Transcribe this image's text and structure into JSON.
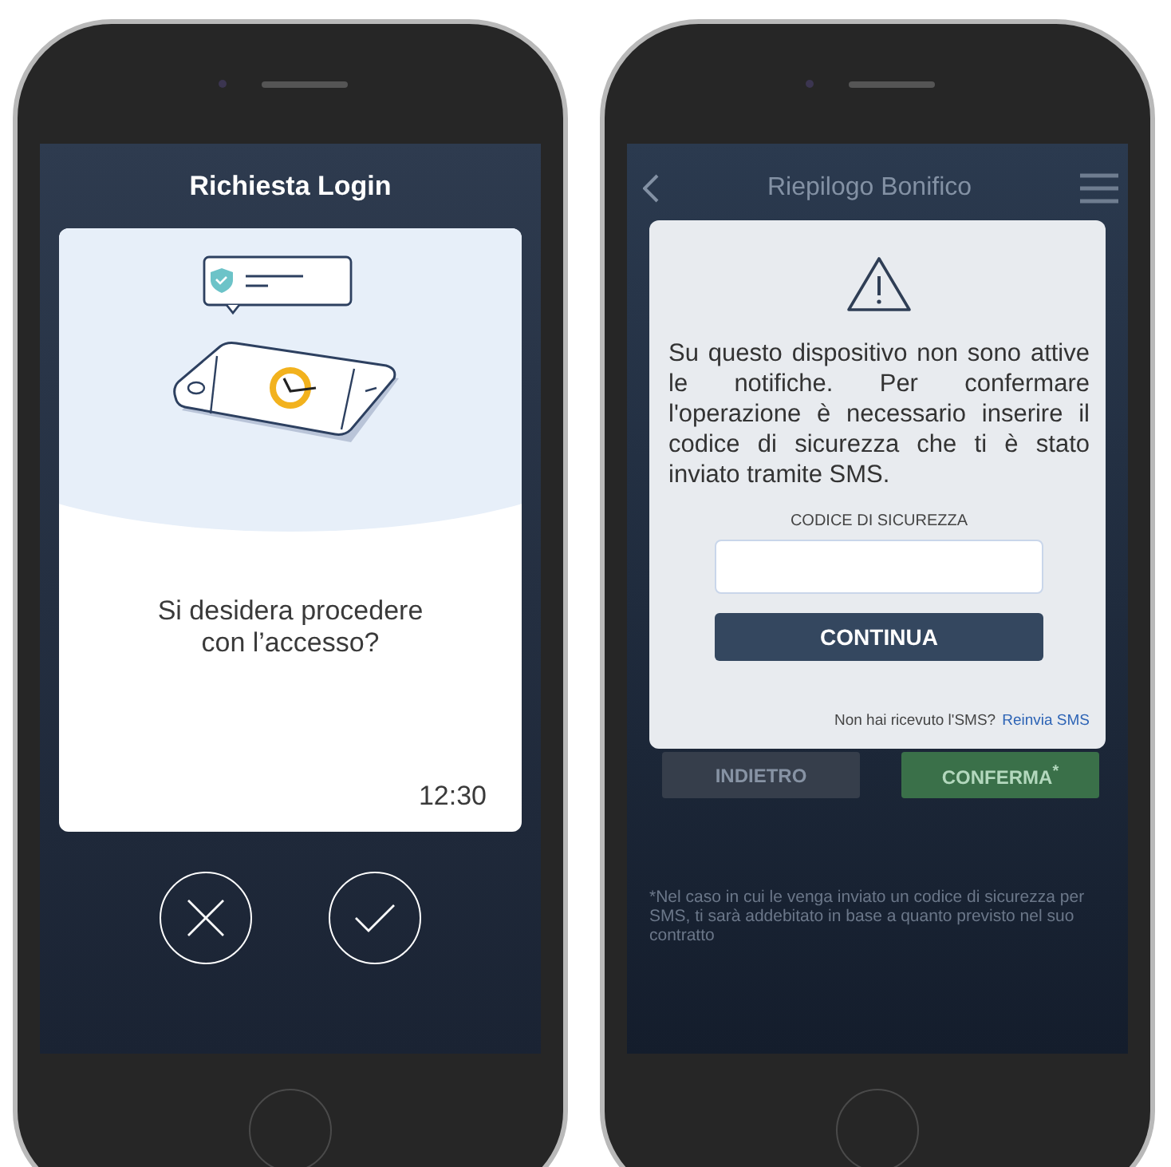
{
  "login_phone": {
    "title": "Richiesta Login",
    "question": "Si desidera procedere con l’accesso?",
    "time": "12:30"
  },
  "transfer_phone": {
    "title": "Riepilogo Bonifico",
    "dialog": {
      "message": "Su questo dispositivo non sono attive le notifiche. Per confermare l'operazione è necessario inserire il codice di sicurezza che ti è stato inviato tramite SMS.",
      "code_label": "CODICE DI SICUREZZA",
      "button": "CONTINUA",
      "resend_prompt": "Non hai ricevuto l'SMS?",
      "resend_link": "Reinvia SMS"
    },
    "buttons": [
      {
        "label": "INDIETRO",
        "kind": "back"
      },
      {
        "label": "CONFERMA$^{*}$",
        "kind": "confirm"
      }
    ],
    "footnote": "*Nel caso in cui le venga inviato un codice di sicurezza per SMS, ti sarà addebitato in base a quanto previsto nel suo contratto"
  }
}
